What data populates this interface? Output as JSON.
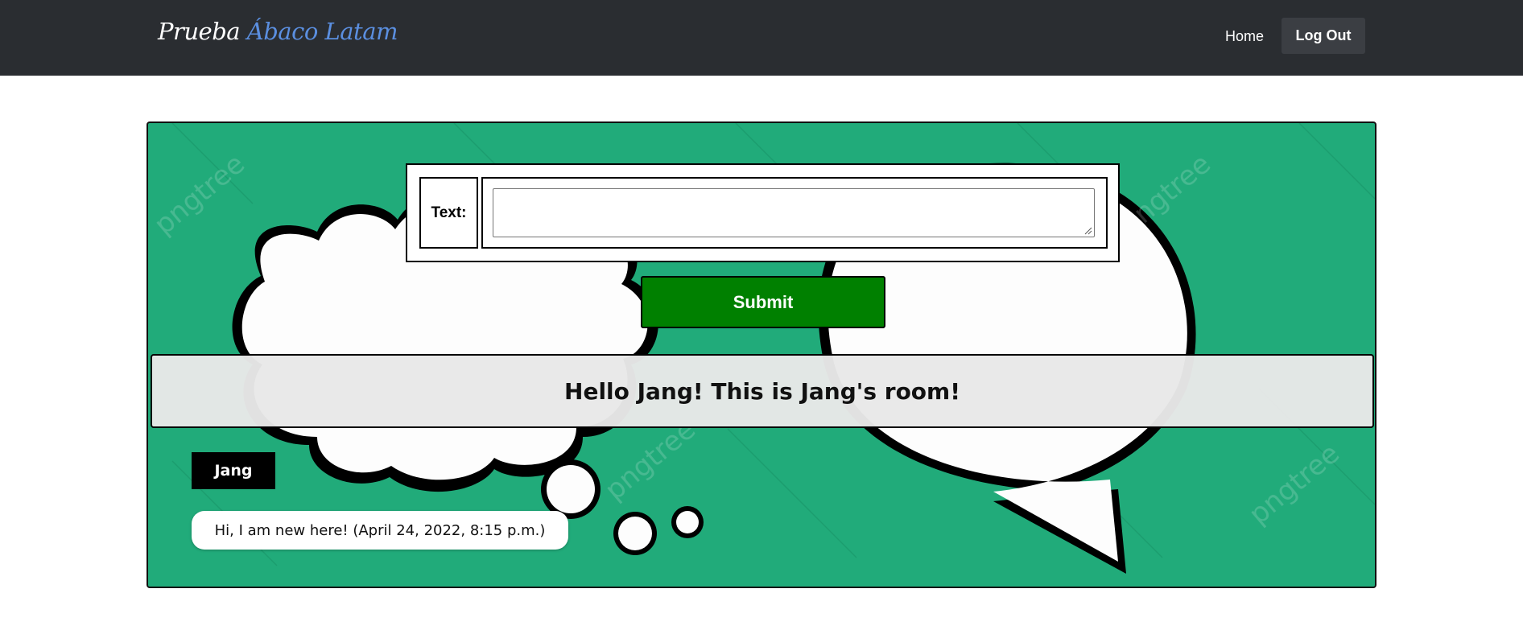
{
  "navbar": {
    "brand_part1": "Prueba",
    "brand_part2": "Ábaco Latam",
    "home_label": "Home",
    "logout_label": "Log Out",
    "background_color": "#2a2d31",
    "brand_accent_color": "#5b8fe0"
  },
  "room": {
    "background_color": "#21ab7a",
    "watermark_text": "pngtree",
    "form": {
      "text_label": "Text:",
      "text_value": "",
      "submit_label": "Submit",
      "submit_color": "#008000"
    },
    "title": "Hello Jang! This is Jang's room!",
    "messages": [
      {
        "user": "Jang",
        "text": "Hi, I am new here! (April 24, 2022, 8:15 p.m.)"
      }
    ]
  }
}
